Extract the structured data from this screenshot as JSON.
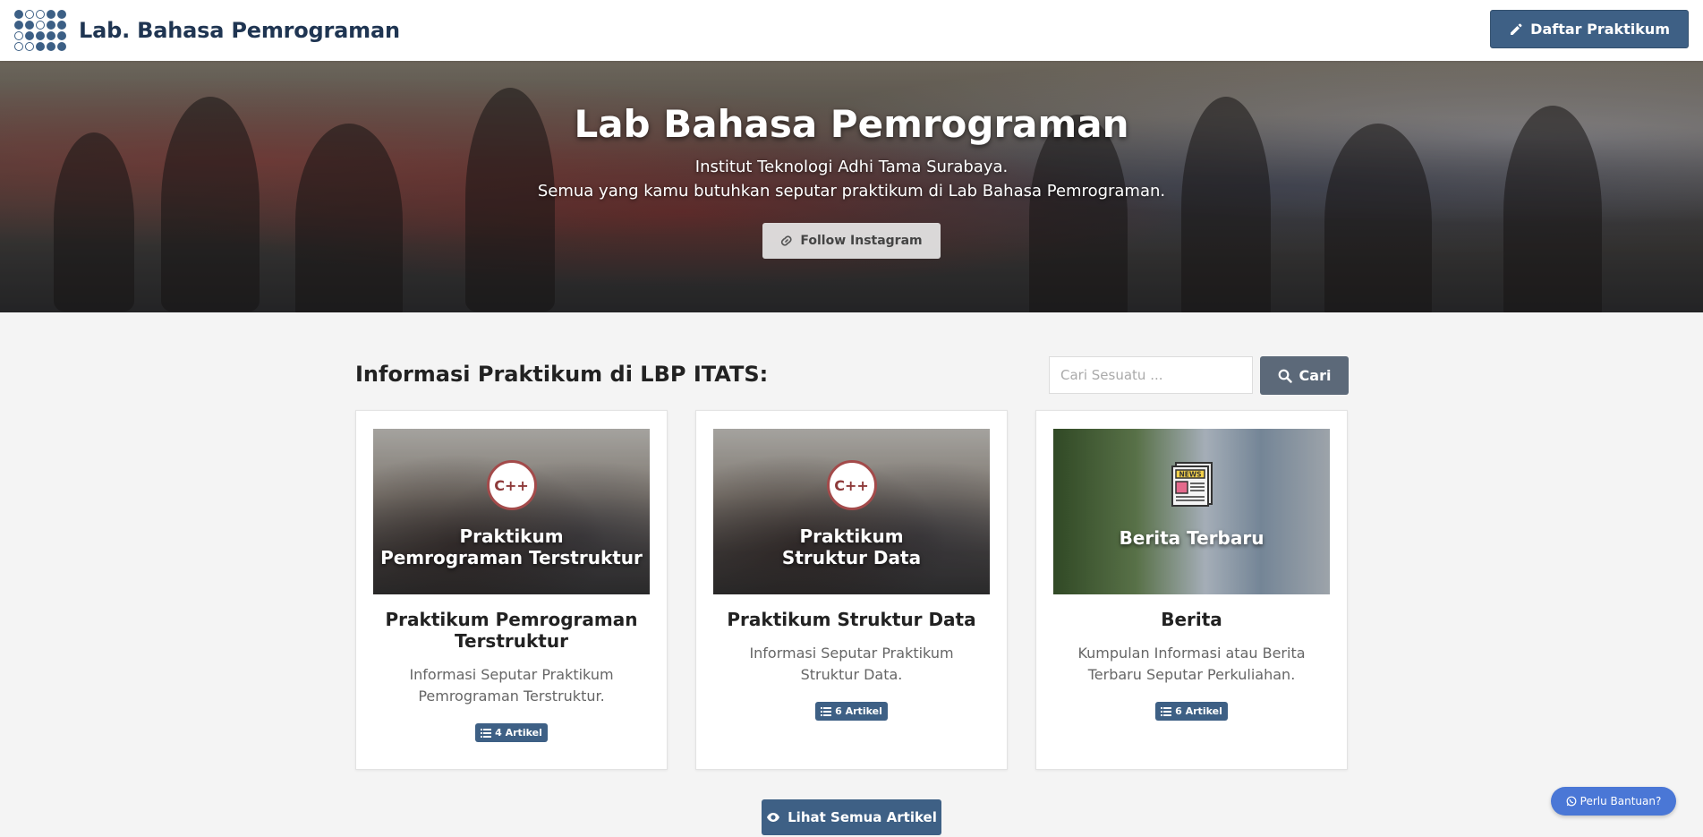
{
  "navbar": {
    "brand_title": "Lab. Bahasa Pemrograman",
    "register_button": "Daftar Praktikum",
    "logo_icon": "dot-grid-logo"
  },
  "hero": {
    "title": "Lab Bahasa Pemrograman",
    "subtitle_line1": "Institut Teknologi Adhi Tama Surabaya.",
    "subtitle_line2": "Semua yang kamu butuhkan seputar praktikum di Lab Bahasa Pemrograman.",
    "instagram_button": "Follow Instagram"
  },
  "section": {
    "title": "Informasi Praktikum di LBP ITATS:",
    "search_placeholder": "Cari Sesuatu ...",
    "search_button": "Cari"
  },
  "cards": [
    {
      "image_label_line1": "Praktikum",
      "image_label_line2": "Pemrograman Terstruktur",
      "image_icon": "c-plus-plus-icon",
      "title": "Praktikum Pemrograman Terstruktur",
      "description": "Informasi Seputar Praktikum Pemrograman Terstruktur.",
      "badge": "4 Artikel"
    },
    {
      "image_label_line1": "Praktikum",
      "image_label_line2": "Struktur Data",
      "image_icon": "c-plus-plus-icon",
      "title": "Praktikum Struktur Data",
      "description": "Informasi Seputar Praktikum Struktur Data.",
      "badge": "6 Artikel"
    },
    {
      "image_label_line1": "Berita Terbaru",
      "image_icon": "newspaper-icon",
      "title": "Berita",
      "description": "Kumpulan Informasi atau Berita Terbaru Seputar Perkuliahan.",
      "badge": "6 Artikel"
    }
  ],
  "footer_actions": {
    "view_all_button": "Lihat Semua Artikel",
    "help_button": "Perlu Bantuan?"
  },
  "colors": {
    "primary": "#3e6085",
    "search_button": "#5c6979",
    "help_button": "#4a77d6"
  }
}
